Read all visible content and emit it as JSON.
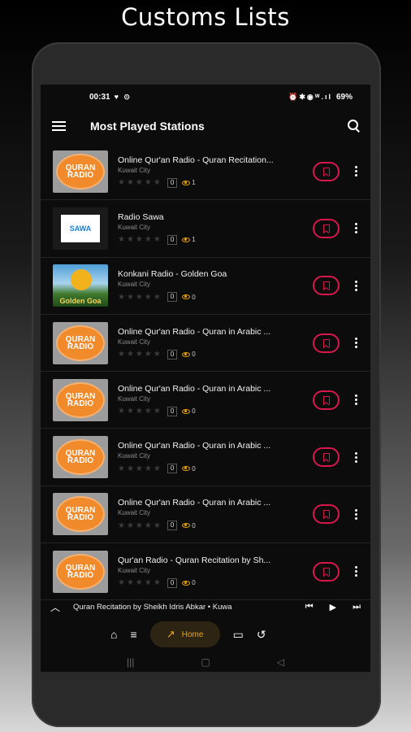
{
  "headline": "Customs Lists",
  "status_bar": {
    "time": "00:31",
    "battery": "69%"
  },
  "app_bar": {
    "title": "Most Played Stations"
  },
  "stations": [
    {
      "name": "Online Qur'an Radio - Quran Recitation...",
      "city": "Kuwait City",
      "rating": "0",
      "views": "1",
      "logo": "quran"
    },
    {
      "name": "Radio Sawa",
      "city": "Kuwait City",
      "rating": "0",
      "views": "1",
      "logo": "sawa"
    },
    {
      "name": "Konkani Radio - Golden Goa",
      "city": "Kuwait City",
      "rating": "0",
      "views": "0",
      "logo": "goa"
    },
    {
      "name": "Online Qur'an Radio - Quran in Arabic ...",
      "city": "Kuwait City",
      "rating": "0",
      "views": "0",
      "logo": "quran"
    },
    {
      "name": "Online Qur'an Radio - Quran in Arabic ...",
      "city": "Kuwait City",
      "rating": "0",
      "views": "0",
      "logo": "quran"
    },
    {
      "name": "Online Qur'an Radio - Quran in Arabic ...",
      "city": "Kuwait City",
      "rating": "0",
      "views": "0",
      "logo": "quran"
    },
    {
      "name": "Online Qur'an Radio - Quran in Arabic ...",
      "city": "Kuwait City",
      "rating": "0",
      "views": "0",
      "logo": "quran"
    },
    {
      "name": "Qur'an Radio - Quran Recitation by Sh...",
      "city": "Kuwait City",
      "rating": "0",
      "views": "0",
      "logo": "quran"
    }
  ],
  "logo_text": {
    "quran": "QURAN RADIO",
    "sawa": "SAWA",
    "goa": "Golden Goa"
  },
  "player": {
    "now_playing": "Quran Recitation by Sheikh Idris Abkar • Kuwa"
  },
  "bottom_nav": {
    "home_label": "Home"
  },
  "colors": {
    "accent": "#f0a500",
    "bookmark": "#d8184c",
    "background": "#0c0c0c"
  }
}
